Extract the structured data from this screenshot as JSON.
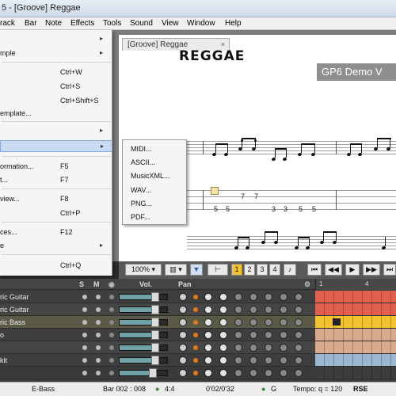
{
  "window": {
    "title": "5 - [Groove] Reggae"
  },
  "menubar": [
    "rack",
    "Bar",
    "Note",
    "Effects",
    "Tools",
    "Sound",
    "View",
    "Window",
    "Help"
  ],
  "document": {
    "tab_label": "[Groove] Reggae",
    "tab_close": "×",
    "score_title": "REGGAE",
    "demo_banner": "GP6 Demo V",
    "tab_numbers": [
      "7",
      "7",
      "5",
      "5",
      "3",
      "3",
      "5",
      "5"
    ]
  },
  "file_menu": {
    "items": [
      {
        "label": "",
        "shortcut": "",
        "arrow": "▸"
      },
      {
        "label": "mple",
        "shortcut": "",
        "arrow": "▸"
      },
      {
        "label": "",
        "shortcut": "Ctrl+W",
        "arrow": ""
      },
      {
        "label": "",
        "shortcut": "Ctrl+S",
        "arrow": ""
      },
      {
        "label": "",
        "shortcut": "Ctrl+Shift+S",
        "arrow": ""
      },
      {
        "label": "emplate...",
        "shortcut": "",
        "arrow": ""
      },
      {
        "label": "",
        "shortcut": "",
        "arrow": "▸"
      },
      {
        "label": "",
        "shortcut": "",
        "arrow": "▸"
      },
      {
        "label": "ormation...",
        "shortcut": "F5",
        "arrow": ""
      },
      {
        "label": "t...",
        "shortcut": "F7",
        "arrow": ""
      },
      {
        "label": "view...",
        "shortcut": "F8",
        "arrow": ""
      },
      {
        "label": "",
        "shortcut": "Ctrl+P",
        "arrow": ""
      },
      {
        "label": "ces...",
        "shortcut": "F12",
        "arrow": ""
      },
      {
        "label": "e",
        "shortcut": "",
        "arrow": "▸"
      },
      {
        "label": "",
        "shortcut": "Ctrl+Q",
        "arrow": ""
      }
    ]
  },
  "export_submenu": {
    "items": [
      "MIDI...",
      "ASCII...",
      "MusicXML...",
      "WAV...",
      "PNG...",
      "PDF..."
    ]
  },
  "toolbar": {
    "zoom": "100%",
    "zoom_arrow": "▾",
    "layout_arrow": "▾",
    "pages": [
      "1",
      "2",
      "3",
      "4"
    ],
    "transport_icons": [
      "⏮",
      "◀◀",
      "▶",
      "▶▶",
      "⏭"
    ]
  },
  "track_panel": {
    "header": {
      "solo": "S",
      "mute": "M",
      "vol": "Vol.",
      "pan": "Pan"
    },
    "timeline_marks": [
      "1",
      "4"
    ],
    "tracks": [
      {
        "name": "ric Guitar",
        "volume": 0.8,
        "color": "#e06050"
      },
      {
        "name": "ric Guitar",
        "volume": 0.8,
        "color": "#e06050"
      },
      {
        "name": "ric Bass",
        "volume": 0.8,
        "color": "#f2c230"
      },
      {
        "name": "o",
        "volume": 0.8,
        "color": "#d9a98b"
      },
      {
        "name": "",
        "volume": 0.8,
        "color": "#d9a98b"
      },
      {
        "name": "kit",
        "volume": 0.8,
        "color": "#9ab6d0"
      },
      {
        "name": "",
        "volume": 0.75,
        "color": "#3c3c3c"
      }
    ]
  },
  "status": {
    "track": "E-Bass",
    "bar": "Bar 002 : 008",
    "signature": "4:4",
    "time": "0'02/0'32",
    "key": "G",
    "tempo": "Tempo: q = 120",
    "rse": "RSE"
  },
  "colors": {
    "highlight": "#c9dbf2",
    "page_active": "#f2c230"
  }
}
